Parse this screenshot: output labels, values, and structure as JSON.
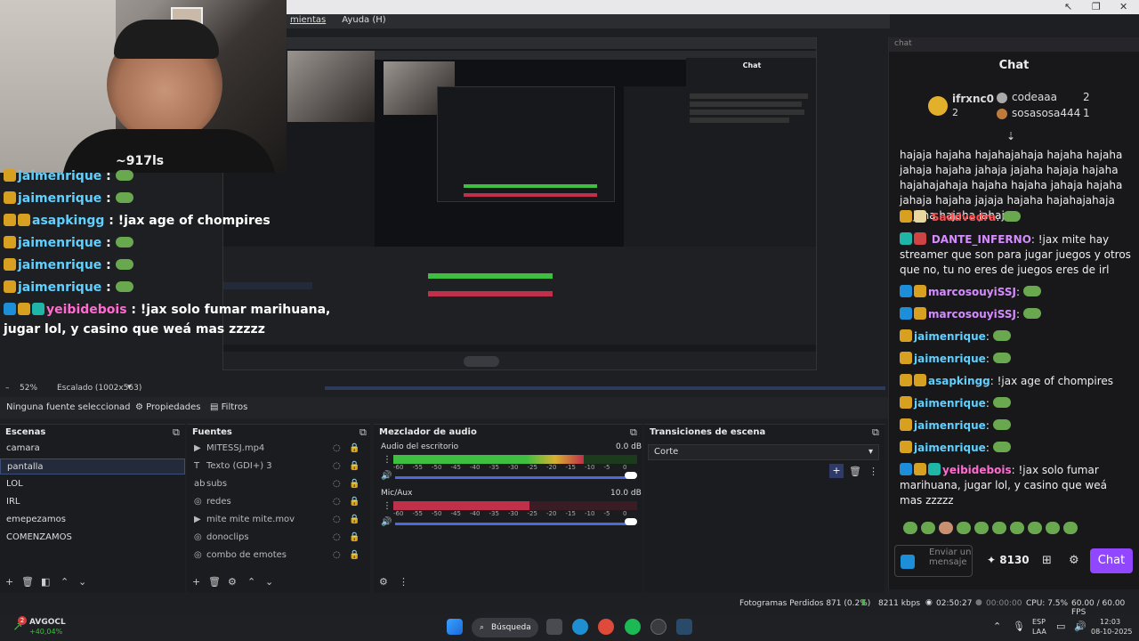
{
  "menubar": {
    "items": [
      "mientas",
      "Ayuda (H)"
    ]
  },
  "overlay_chat": [
    {
      "name": "jaimenrique",
      "text": ":"
    },
    {
      "name": "jaimenrique",
      "text": ":"
    },
    {
      "name": "asapkingg",
      "text": ": !jax age of chompires"
    },
    {
      "name": "jaimenrique",
      "text": ":"
    },
    {
      "name": "jaimenrique",
      "text": ":"
    },
    {
      "name": "jaimenrique",
      "text": ":"
    },
    {
      "name": "yeibidebois",
      "text": ": !jax solo fumar marihuana,"
    },
    {
      "name": "",
      "text": "jugar lol, y casino que weá mas zzzzz"
    }
  ],
  "webcam": {
    "shirt_text": "~917ls"
  },
  "preview_chat": {
    "title": "Chat"
  },
  "chat": {
    "window_title": "chat",
    "header": "Chat",
    "leaderboard": {
      "first": {
        "name": "ifrxnc0",
        "count": "2"
      },
      "second": {
        "name": "codeaaa",
        "count": "2"
      },
      "third": {
        "name": "sosasosa444",
        "count": "1"
      }
    },
    "messages": [
      {
        "name": "",
        "text": "hajaja hajaha hajahajahaja hajaha hajaha jahaja hajaha jahaja jajaha hajaja hajaha hajahajahaja hajaha hajaha jahaja hajaha jahaja hajaha jajaja hajaha hajahajahaja hajaha hajaha jahaja"
      },
      {
        "name": "Saddvedra",
        "text": ":"
      },
      {
        "name": "DANTE_INFERNO",
        "text": ": !jax mite hay streamer que son para jugar juegos y otros que no, tu no eres de juegos eres de irl"
      },
      {
        "name": "marcosouyiSSJ",
        "text": ":"
      },
      {
        "name": "marcosouyiSSJ",
        "text": ":"
      },
      {
        "name": "jaimenrique",
        "text": ":"
      },
      {
        "name": "jaimenrique",
        "text": ":"
      },
      {
        "name": "asapkingg",
        "text": ": !jax age of chompires"
      },
      {
        "name": "jaimenrique",
        "text": ":"
      },
      {
        "name": "jaimenrique",
        "text": ":"
      },
      {
        "name": "jaimenrique",
        "text": ":"
      },
      {
        "name": "yeibidebois",
        "text": ": !jax solo fumar marihuana, jugar lol, y casino que weá mas zzzzz"
      }
    ],
    "input_placeholder": "Enviar un mensaje",
    "points": "8130",
    "send_label": "Chat"
  },
  "obs": {
    "zoom": "52%",
    "scale": "Escalado (1002x563)",
    "no_source": "Ninguna fuente seleccionad",
    "properties": "Propiedades",
    "filters": "Filtros",
    "scenes_title": "Escenas",
    "scenes": [
      "camara",
      "pantalla",
      "LOL",
      "IRL",
      "emepezamos",
      "COMENZAMOS"
    ],
    "sources_title": "Fuentes",
    "sources": [
      "MITESSJ.mp4",
      "Texto (GDI+) 3",
      "subs",
      "redes",
      "mite mite mite.mov",
      "donoclips",
      "combo de emotes"
    ],
    "mixer_title": "Mezclador de audio",
    "mixer": [
      {
        "name": "Audio del escritorio",
        "db": "0.0 dB",
        "level": 0.78
      },
      {
        "name": "Mic/Aux",
        "db": "10.0 dB",
        "level": 0.56
      }
    ],
    "mixer_ticks": [
      "-60",
      "-55",
      "-50",
      "-45",
      "-40",
      "-35",
      "-30",
      "-25",
      "-20",
      "-15",
      "-10",
      "-5",
      "0"
    ],
    "transitions_title": "Transiciones de escena",
    "transition": "Corte"
  },
  "status": {
    "dropped": "Fotogramas Perdidos 871 (0.2%)",
    "bitrate": "8211 kbps",
    "time1": "02:50:27",
    "time2": "00:00:00",
    "cpu": "CPU: 7.5%",
    "fps": "60.00 / 60.00 FPS"
  },
  "taskbar": {
    "stock_name": "AVGOCL",
    "stock_change": "+40,04%",
    "stock_badge": "2",
    "search": "Búsqueda",
    "lang1": "ESP",
    "lang2": "LAA",
    "time": "12:03",
    "date": "08-10-2025"
  },
  "colors": {
    "accent": "#9147ff",
    "meter_green": "#3fbf3f",
    "meter_red": "#c0304a",
    "chat_name_blue": "#5fd0ff",
    "chat_name_pink": "#ff6bd1"
  }
}
